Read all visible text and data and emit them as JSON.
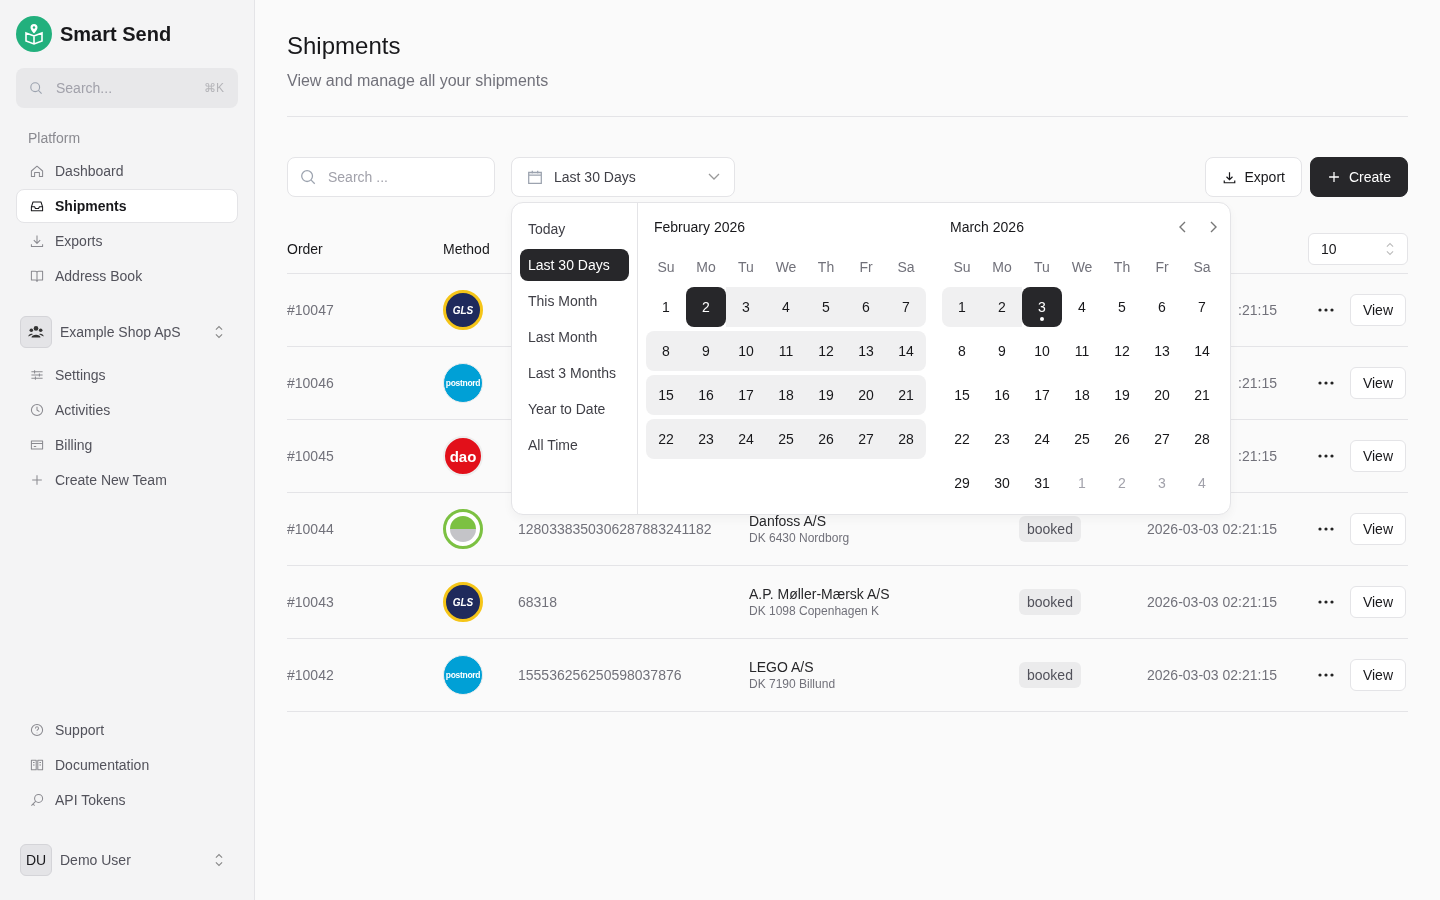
{
  "app": {
    "name": "Smart Send"
  },
  "sidebar": {
    "search": {
      "placeholder": "Search...",
      "shortcut": "⌘K"
    },
    "section_label": "Platform",
    "nav": [
      {
        "label": "Dashboard",
        "kind": "home",
        "selected": false
      },
      {
        "label": "Shipments",
        "kind": "inbox",
        "selected": true
      },
      {
        "label": "Exports",
        "kind": "download",
        "selected": false
      },
      {
        "label": "Address Book",
        "kind": "book",
        "selected": false
      }
    ],
    "team": {
      "name": "Example Shop ApS"
    },
    "team_nav": [
      {
        "label": "Settings",
        "kind": "sliders"
      },
      {
        "label": "Activities",
        "kind": "clock"
      },
      {
        "label": "Billing",
        "kind": "card"
      },
      {
        "label": "Create New Team",
        "kind": "plus"
      }
    ],
    "footer_nav": [
      {
        "label": "Support",
        "kind": "help"
      },
      {
        "label": "Documentation",
        "kind": "docs"
      },
      {
        "label": "API Tokens",
        "kind": "key"
      }
    ],
    "user": {
      "initials": "DU",
      "name": "Demo User"
    }
  },
  "page": {
    "title": "Shipments",
    "subtitle": "View and manage all your shipments"
  },
  "toolbar": {
    "search": {
      "placeholder": "Search ..."
    },
    "date_range": {
      "value": "Last 30 Days"
    },
    "buttons": [
      {
        "label": "Export",
        "kind": "secondary"
      },
      {
        "label": "Create",
        "kind": "primary"
      }
    ]
  },
  "date_popup": {
    "presets": [
      {
        "label": "Today",
        "selected": false
      },
      {
        "label": "Last 30 Days",
        "selected": true
      },
      {
        "label": "This Month",
        "selected": false
      },
      {
        "label": "Last Month",
        "selected": false
      },
      {
        "label": "Last 3 Months",
        "selected": false
      },
      {
        "label": "Year to Date",
        "selected": false
      },
      {
        "label": "All Time",
        "selected": false
      }
    ],
    "months": [
      {
        "title": "February 2026",
        "weekdays": [
          "Su",
          "Mo",
          "Tu",
          "We",
          "Th",
          "Fr",
          "Sa"
        ],
        "days": [
          {
            "label": "1",
            "in_range": false,
            "selected": false,
            "outside": false,
            "today": false
          },
          {
            "label": "2",
            "in_range": true,
            "selected": true,
            "outside": false,
            "today": false
          },
          {
            "label": "3",
            "in_range": true,
            "selected": false,
            "outside": false,
            "today": false
          },
          {
            "label": "4",
            "in_range": true,
            "selected": false,
            "outside": false,
            "today": false
          },
          {
            "label": "5",
            "in_range": true,
            "selected": false,
            "outside": false,
            "today": false
          },
          {
            "label": "6",
            "in_range": true,
            "selected": false,
            "outside": false,
            "today": false
          },
          {
            "label": "7",
            "in_range": true,
            "selected": false,
            "outside": false,
            "today": false
          },
          {
            "label": "8",
            "in_range": true,
            "selected": false,
            "outside": false,
            "today": false
          },
          {
            "label": "9",
            "in_range": true,
            "selected": false,
            "outside": false,
            "today": false
          },
          {
            "label": "10",
            "in_range": true,
            "selected": false,
            "outside": false,
            "today": false
          },
          {
            "label": "11",
            "in_range": true,
            "selected": false,
            "outside": false,
            "today": false
          },
          {
            "label": "12",
            "in_range": true,
            "selected": false,
            "outside": false,
            "today": false
          },
          {
            "label": "13",
            "in_range": true,
            "selected": false,
            "outside": false,
            "today": false
          },
          {
            "label": "14",
            "in_range": true,
            "selected": false,
            "outside": false,
            "today": false
          },
          {
            "label": "15",
            "in_range": true,
            "selected": false,
            "outside": false,
            "today": false
          },
          {
            "label": "16",
            "in_range": true,
            "selected": false,
            "outside": false,
            "today": false
          },
          {
            "label": "17",
            "in_range": true,
            "selected": false,
            "outside": false,
            "today": false
          },
          {
            "label": "18",
            "in_range": true,
            "selected": false,
            "outside": false,
            "today": false
          },
          {
            "label": "19",
            "in_range": true,
            "selected": false,
            "outside": false,
            "today": false
          },
          {
            "label": "20",
            "in_range": true,
            "selected": false,
            "outside": false,
            "today": false
          },
          {
            "label": "21",
            "in_range": true,
            "selected": false,
            "outside": false,
            "today": false
          },
          {
            "label": "22",
            "in_range": true,
            "selected": false,
            "outside": false,
            "today": false
          },
          {
            "label": "23",
            "in_range": true,
            "selected": false,
            "outside": false,
            "today": false
          },
          {
            "label": "24",
            "in_range": true,
            "selected": false,
            "outside": false,
            "today": false
          },
          {
            "label": "25",
            "in_range": true,
            "selected": false,
            "outside": false,
            "today": false
          },
          {
            "label": "26",
            "in_range": true,
            "selected": false,
            "outside": false,
            "today": false
          },
          {
            "label": "27",
            "in_range": true,
            "selected": false,
            "outside": false,
            "today": false
          },
          {
            "label": "28",
            "in_range": true,
            "selected": false,
            "outside": false,
            "today": false
          }
        ]
      },
      {
        "title": "March 2026",
        "weekdays": [
          "Su",
          "Mo",
          "Tu",
          "We",
          "Th",
          "Fr",
          "Sa"
        ],
        "days": [
          {
            "label": "1",
            "in_range": true,
            "selected": false,
            "outside": false,
            "today": false
          },
          {
            "label": "2",
            "in_range": true,
            "selected": false,
            "outside": false,
            "today": false
          },
          {
            "label": "3",
            "in_range": true,
            "selected": true,
            "outside": false,
            "today": true
          },
          {
            "label": "4",
            "in_range": false,
            "selected": false,
            "outside": false,
            "today": false
          },
          {
            "label": "5",
            "in_range": false,
            "selected": false,
            "outside": false,
            "today": false
          },
          {
            "label": "6",
            "in_range": false,
            "selected": false,
            "outside": false,
            "today": false
          },
          {
            "label": "7",
            "in_range": false,
            "selected": false,
            "outside": false,
            "today": false
          },
          {
            "label": "8",
            "in_range": false,
            "selected": false,
            "outside": false,
            "today": false
          },
          {
            "label": "9",
            "in_range": false,
            "selected": false,
            "outside": false,
            "today": false
          },
          {
            "label": "10",
            "in_range": false,
            "selected": false,
            "outside": false,
            "today": false
          },
          {
            "label": "11",
            "in_range": false,
            "selected": false,
            "outside": false,
            "today": false
          },
          {
            "label": "12",
            "in_range": false,
            "selected": false,
            "outside": false,
            "today": false
          },
          {
            "label": "13",
            "in_range": false,
            "selected": false,
            "outside": false,
            "today": false
          },
          {
            "label": "14",
            "in_range": false,
            "selected": false,
            "outside": false,
            "today": false
          },
          {
            "label": "15",
            "in_range": false,
            "selected": false,
            "outside": false,
            "today": false
          },
          {
            "label": "16",
            "in_range": false,
            "selected": false,
            "outside": false,
            "today": false
          },
          {
            "label": "17",
            "in_range": false,
            "selected": false,
            "outside": false,
            "today": false
          },
          {
            "label": "18",
            "in_range": false,
            "selected": false,
            "outside": false,
            "today": false
          },
          {
            "label": "19",
            "in_range": false,
            "selected": false,
            "outside": false,
            "today": false
          },
          {
            "label": "20",
            "in_range": false,
            "selected": false,
            "outside": false,
            "today": false
          },
          {
            "label": "21",
            "in_range": false,
            "selected": false,
            "outside": false,
            "today": false
          },
          {
            "label": "22",
            "in_range": false,
            "selected": false,
            "outside": false,
            "today": false
          },
          {
            "label": "23",
            "in_range": false,
            "selected": false,
            "outside": false,
            "today": false
          },
          {
            "label": "24",
            "in_range": false,
            "selected": false,
            "outside": false,
            "today": false
          },
          {
            "label": "25",
            "in_range": false,
            "selected": false,
            "outside": false,
            "today": false
          },
          {
            "label": "26",
            "in_range": false,
            "selected": false,
            "outside": false,
            "today": false
          },
          {
            "label": "27",
            "in_range": false,
            "selected": false,
            "outside": false,
            "today": false
          },
          {
            "label": "28",
            "in_range": false,
            "selected": false,
            "outside": false,
            "today": false
          },
          {
            "label": "29",
            "in_range": false,
            "selected": false,
            "outside": false,
            "today": false
          },
          {
            "label": "30",
            "in_range": false,
            "selected": false,
            "outside": false,
            "today": false
          },
          {
            "label": "31",
            "in_range": false,
            "selected": false,
            "outside": false,
            "today": false
          },
          {
            "label": "1",
            "in_range": false,
            "selected": false,
            "outside": true,
            "today": false
          },
          {
            "label": "2",
            "in_range": false,
            "selected": false,
            "outside": true,
            "today": false
          },
          {
            "label": "3",
            "in_range": false,
            "selected": false,
            "outside": true,
            "today": false
          },
          {
            "label": "4",
            "in_range": false,
            "selected": false,
            "outside": true,
            "today": false
          }
        ]
      }
    ]
  },
  "table": {
    "columns": [
      "Order",
      "Method"
    ],
    "page_size": "10",
    "rows": [
      {
        "order": "#10047",
        "method": {
          "kind": "gls",
          "text": "GLS"
        },
        "time": ":21:15",
        "action": "View"
      },
      {
        "order": "#10046",
        "method": {
          "kind": "postnord",
          "text": "postnord"
        },
        "time": ":21:15",
        "action": "View"
      },
      {
        "order": "#10045",
        "method": {
          "kind": "dao",
          "text": "dao"
        },
        "time": ":21:15",
        "action": "View"
      },
      {
        "order": "#10044",
        "method": {
          "kind": "ring"
        },
        "tracking": "1280338350306287883241182",
        "customer": "Danfoss A/S",
        "address": "DK 6430 Nordborg",
        "status": "booked",
        "time": "2026-03-03 02:21:15",
        "action": "View"
      },
      {
        "order": "#10043",
        "method": {
          "kind": "gls",
          "text": "GLS"
        },
        "tracking": "68318",
        "customer": "A.P. Møller-Mærsk A/S",
        "address": "DK 1098 Copenhagen K",
        "status": "booked",
        "time": "2026-03-03 02:21:15",
        "action": "View"
      },
      {
        "order": "#10042",
        "method": {
          "kind": "postnord",
          "text": "postnord"
        },
        "tracking": "155536256250598037876",
        "customer": "LEGO A/S",
        "address": "DK 7190 Billund",
        "status": "booked",
        "time": "2026-03-03 02:21:15",
        "action": "View"
      }
    ]
  }
}
